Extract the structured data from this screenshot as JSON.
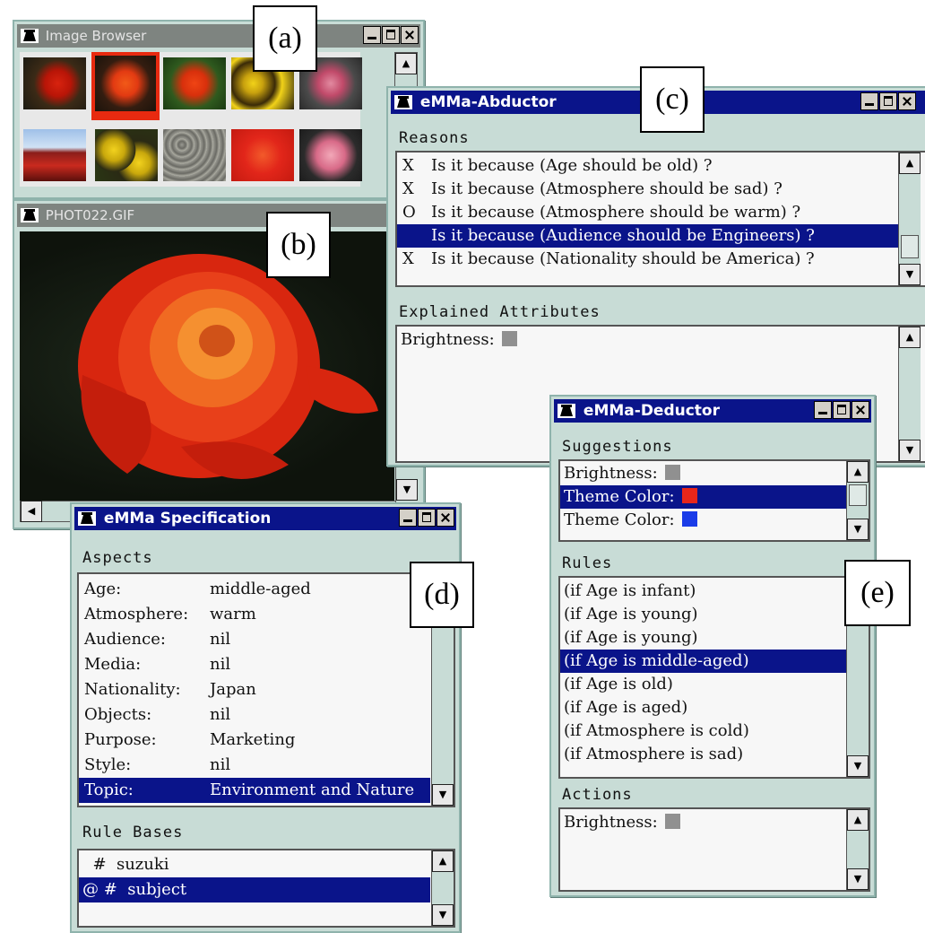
{
  "label_a": "(a)",
  "label_b": "(b)",
  "label_c": "(c)",
  "label_d": "(d)",
  "label_e": "(e)",
  "image_browser": {
    "title": "Image Browser",
    "icons": [
      "flower-thumbnail-icon",
      "flower-thumbnail-icon",
      "flower-thumbnail-icon",
      "flower-thumbnail-icon",
      "flower-thumbnail-icon",
      "tulip-field-thumbnail-icon",
      "pansy-thumbnail-icon",
      "pebbles-thumbnail-icon",
      "rose-thumbnail-icon",
      "camellia-thumbnail-icon"
    ]
  },
  "photo": {
    "title": "PHOT022.GIF",
    "icon": "red-rose-photo"
  },
  "abductor": {
    "title": "eMMa-Abductor",
    "reasons_label": "Reasons",
    "reasons": [
      {
        "mark": "X",
        "text": "Is it because (Age should be old) ?"
      },
      {
        "mark": "X",
        "text": "Is it because (Atmosphere should be sad) ?"
      },
      {
        "mark": "O",
        "text": "Is it because (Atmosphere should be warm) ?"
      },
      {
        "mark": "",
        "text": "Is it because (Audience should be Engineers) ?"
      },
      {
        "mark": "X",
        "text": "Is it because (Nationality should be America) ?"
      }
    ],
    "explained_label": "Explained Attributes",
    "explained": [
      {
        "text": "Brightness:",
        "swatch": "#909090"
      }
    ]
  },
  "deductor": {
    "title": "eMMa-Deductor",
    "suggestions_label": "Suggestions",
    "suggestions": [
      {
        "text": "Brightness:",
        "swatch": "#909090"
      },
      {
        "text": "Theme Color:",
        "swatch": "#e8261a"
      },
      {
        "text": "Theme Color:",
        "swatch": "#1a3ce8"
      }
    ],
    "rules_label": "Rules",
    "rules": [
      "(if Age is infant)",
      "(if Age is young)",
      "(if Age is young)",
      "(if Age is middle-aged)",
      "(if Age is old)",
      "(if Age is aged)",
      "(if Atmosphere is cold)",
      "(if Atmosphere is sad)"
    ],
    "actions_label": "Actions",
    "actions": [
      {
        "text": "Brightness:",
        "swatch": "#909090"
      }
    ]
  },
  "spec": {
    "title": "eMMa Specification",
    "aspects_label": "Aspects",
    "aspects": [
      {
        "key": "Age:",
        "value": "middle-aged"
      },
      {
        "key": "Atmosphere:",
        "value": "warm"
      },
      {
        "key": "Audience:",
        "value": "nil"
      },
      {
        "key": "Media:",
        "value": "nil"
      },
      {
        "key": "Nationality:",
        "value": "Japan"
      },
      {
        "key": "Objects:",
        "value": "nil"
      },
      {
        "key": "Purpose:",
        "value": "Marketing"
      },
      {
        "key": "Style:",
        "value": "nil"
      },
      {
        "key": "Topic:",
        "value": "Environment and Nature"
      }
    ],
    "rule_bases_label": "Rule Bases",
    "rule_bases": [
      "  #  suzuki",
      "@ #  subject"
    ]
  },
  "colors": {
    "titlebar": "#0a148a",
    "window": "#c8dcd6",
    "selection": "#0a148a"
  }
}
